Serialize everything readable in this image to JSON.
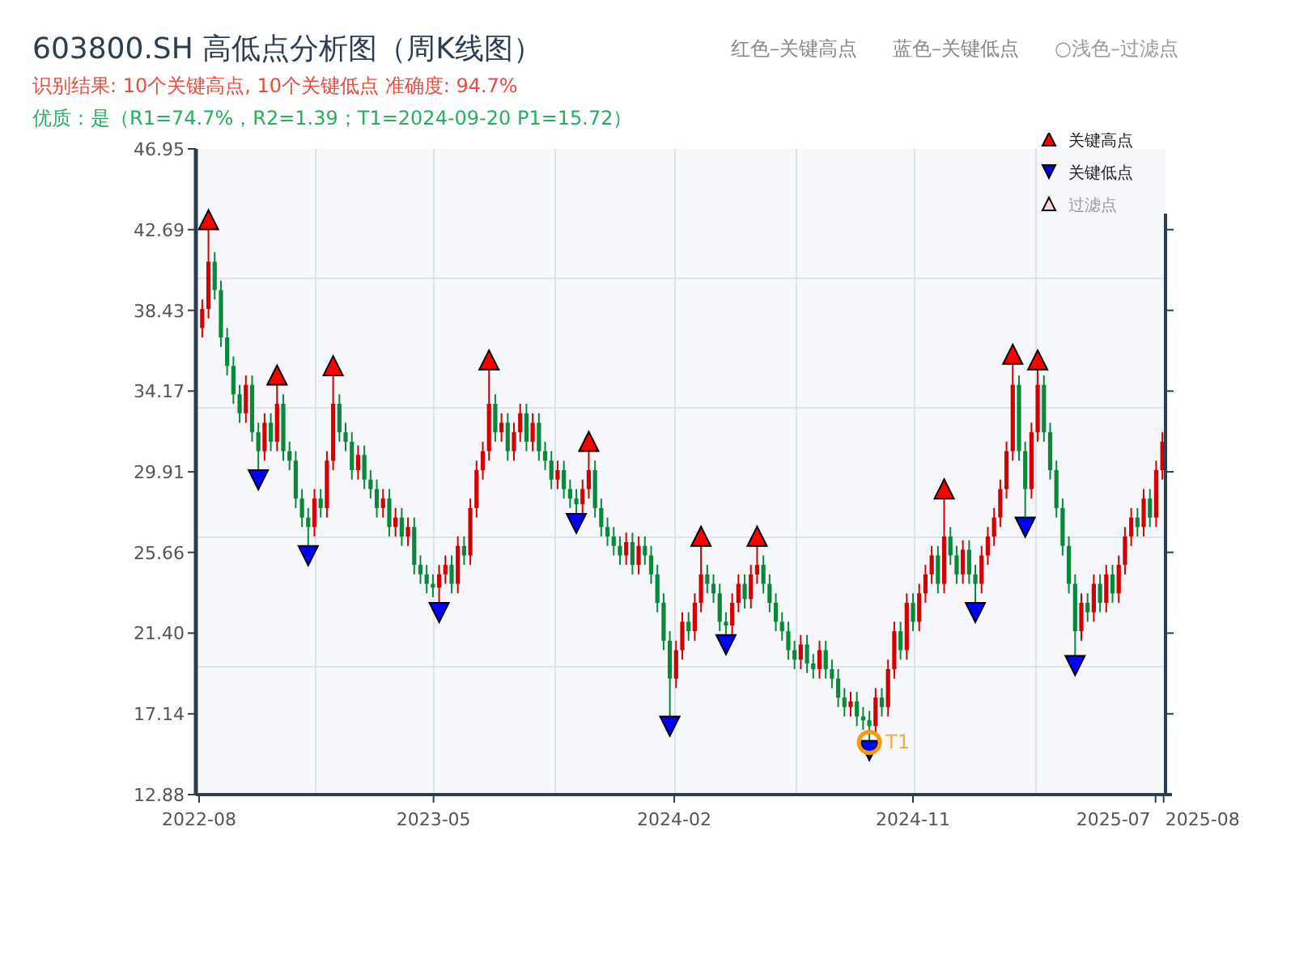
{
  "title": "603800.SH 高低点分析图（周K线图）",
  "top_legend": [
    {
      "kind": "high",
      "label": "红色–关键高点"
    },
    {
      "kind": "low",
      "label": "蓝色–关键低点"
    },
    {
      "kind": "filtered",
      "label": "○浅色–过滤点"
    }
  ],
  "result_line": "识别结果: 10个关键高点, 10个关键低点   准确度: 94.7%",
  "quality_line": "优质：是（R1=74.7%，R2=1.39；T1=2024-09-20 P1=15.72）",
  "chart": {
    "legend": [
      {
        "kind": "high",
        "label": "关键高点"
      },
      {
        "kind": "low",
        "label": "关键低点"
      },
      {
        "kind": "filtered",
        "label": "过滤点"
      }
    ],
    "chart_data": {
      "type": "candlestick",
      "ylim": [
        12.88,
        46.95
      ],
      "yticks": [
        46.95,
        42.69,
        38.43,
        34.17,
        29.91,
        25.66,
        {
          "value": 21.4,
          "label": "21.40"
        },
        17.14,
        12.88
      ],
      "ohlc": [
        [
          37.5,
          39.0,
          37.0,
          38.5
        ],
        [
          38.5,
          42.7,
          38.0,
          41.0
        ],
        [
          41.0,
          41.5,
          39.0,
          39.5
        ],
        [
          39.5,
          40.0,
          36.5,
          37.0
        ],
        [
          37.0,
          37.5,
          35.0,
          35.5
        ],
        [
          35.5,
          36.0,
          33.5,
          34.0
        ],
        [
          34.0,
          34.5,
          32.5,
          33.0
        ],
        [
          33.0,
          35.0,
          32.5,
          34.5
        ],
        [
          34.5,
          35.0,
          31.5,
          32.0
        ],
        [
          32.0,
          32.5,
          30.0,
          31.0
        ],
        [
          31.0,
          33.0,
          30.5,
          32.5
        ],
        [
          32.5,
          33.0,
          31.0,
          31.5
        ],
        [
          31.5,
          34.5,
          31.0,
          33.5
        ],
        [
          33.5,
          34.0,
          30.5,
          31.0
        ],
        [
          31.0,
          31.5,
          30.0,
          30.5
        ],
        [
          30.5,
          31.0,
          28.0,
          28.5
        ],
        [
          28.5,
          29.0,
          27.0,
          27.5
        ],
        [
          27.5,
          28.0,
          26.0,
          27.0
        ],
        [
          27.0,
          29.0,
          26.5,
          28.5
        ],
        [
          28.5,
          29.0,
          27.5,
          28.0
        ],
        [
          28.0,
          31.0,
          27.5,
          30.5
        ],
        [
          30.5,
          35.0,
          30.0,
          33.5
        ],
        [
          33.5,
          34.0,
          31.5,
          32.0
        ],
        [
          32.0,
          32.5,
          31.0,
          31.5
        ],
        [
          31.5,
          32.0,
          29.5,
          30.0
        ],
        [
          30.0,
          31.3,
          29.5,
          30.8
        ],
        [
          30.8,
          31.3,
          29.0,
          29.5
        ],
        [
          29.5,
          30.0,
          28.5,
          29.0
        ],
        [
          29.0,
          29.5,
          27.5,
          28.0
        ],
        [
          28.0,
          29.0,
          27.5,
          28.5
        ],
        [
          28.5,
          29.0,
          26.5,
          27.0
        ],
        [
          27.0,
          28.0,
          26.5,
          27.5
        ],
        [
          27.5,
          28.0,
          26.0,
          26.5
        ],
        [
          26.5,
          27.5,
          26.0,
          27.0
        ],
        [
          27.0,
          27.5,
          24.5,
          25.0
        ],
        [
          25.0,
          25.5,
          24.0,
          24.5
        ],
        [
          24.5,
          25.0,
          23.5,
          24.0
        ],
        [
          24.0,
          24.5,
          23.3,
          23.8
        ],
        [
          23.8,
          25.0,
          23.0,
          24.5
        ],
        [
          24.5,
          25.5,
          24.0,
          25.0
        ],
        [
          25.0,
          25.5,
          23.5,
          24.0
        ],
        [
          24.0,
          26.5,
          23.5,
          26.0
        ],
        [
          26.0,
          26.5,
          25.0,
          25.5
        ],
        [
          25.5,
          28.5,
          25.0,
          28.0
        ],
        [
          28.0,
          30.5,
          27.5,
          30.0
        ],
        [
          30.0,
          31.5,
          29.5,
          31.0
        ],
        [
          31.0,
          35.3,
          30.5,
          33.5
        ],
        [
          33.5,
          34.0,
          31.5,
          32.0
        ],
        [
          32.0,
          33.0,
          31.5,
          32.5
        ],
        [
          32.5,
          33.0,
          30.5,
          31.0
        ],
        [
          31.0,
          32.5,
          30.5,
          32.0
        ],
        [
          32.0,
          33.5,
          31.5,
          33.0
        ],
        [
          33.0,
          33.5,
          31.0,
          31.5
        ],
        [
          31.5,
          33.0,
          31.0,
          32.5
        ],
        [
          32.5,
          33.0,
          30.5,
          31.0
        ],
        [
          31.0,
          31.5,
          30.0,
          30.5
        ],
        [
          30.5,
          31.0,
          29.0,
          29.5
        ],
        [
          29.5,
          30.5,
          29.0,
          30.0
        ],
        [
          30.0,
          30.5,
          28.5,
          29.0
        ],
        [
          29.0,
          29.5,
          28.0,
          28.5
        ],
        [
          28.5,
          29.0,
          27.7,
          28.2
        ],
        [
          28.2,
          29.5,
          27.7,
          29.0
        ],
        [
          29.0,
          31.0,
          28.5,
          30.0
        ],
        [
          30.0,
          30.5,
          27.5,
          28.0
        ],
        [
          28.0,
          28.5,
          26.5,
          27.0
        ],
        [
          27.0,
          27.5,
          26.0,
          26.5
        ],
        [
          26.5,
          27.0,
          25.5,
          26.0
        ],
        [
          26.0,
          26.5,
          25.0,
          25.5
        ],
        [
          25.5,
          26.7,
          25.0,
          26.2
        ],
        [
          26.2,
          26.7,
          24.5,
          25.0
        ],
        [
          25.0,
          26.5,
          24.5,
          26.0
        ],
        [
          26.0,
          26.5,
          25.0,
          25.5
        ],
        [
          25.5,
          26.0,
          24.0,
          24.5
        ],
        [
          24.5,
          25.0,
          22.5,
          23.0
        ],
        [
          23.0,
          23.5,
          20.5,
          21.0
        ],
        [
          21.0,
          21.5,
          17.0,
          19.0
        ],
        [
          19.0,
          21.0,
          18.5,
          20.5
        ],
        [
          20.5,
          22.5,
          20.0,
          22.0
        ],
        [
          22.0,
          22.5,
          21.0,
          21.5
        ],
        [
          21.5,
          23.5,
          21.0,
          23.0
        ],
        [
          23.0,
          26.0,
          22.5,
          24.5
        ],
        [
          24.5,
          25.0,
          23.5,
          24.0
        ],
        [
          24.0,
          24.5,
          23.0,
          23.5
        ],
        [
          23.5,
          24.0,
          21.5,
          22.0
        ],
        [
          22.0,
          22.5,
          21.3,
          21.8
        ],
        [
          21.8,
          23.5,
          21.3,
          23.0
        ],
        [
          23.0,
          24.5,
          22.5,
          24.0
        ],
        [
          24.0,
          24.5,
          22.7,
          23.2
        ],
        [
          23.2,
          25.0,
          22.7,
          24.5
        ],
        [
          24.5,
          26.0,
          24.0,
          25.0
        ],
        [
          25.0,
          25.5,
          23.5,
          24.0
        ],
        [
          24.0,
          24.5,
          22.5,
          23.0
        ],
        [
          23.0,
          23.5,
          21.5,
          22.0
        ],
        [
          22.0,
          22.5,
          21.0,
          21.5
        ],
        [
          21.5,
          22.0,
          20.0,
          20.5
        ],
        [
          20.5,
          21.0,
          19.5,
          20.0
        ],
        [
          20.0,
          21.3,
          19.5,
          20.8
        ],
        [
          20.8,
          21.3,
          19.3,
          19.8
        ],
        [
          19.8,
          20.3,
          19.0,
          19.5
        ],
        [
          19.5,
          21.0,
          19.0,
          20.5
        ],
        [
          20.5,
          21.0,
          19.0,
          19.5
        ],
        [
          19.5,
          20.0,
          18.5,
          19.0
        ],
        [
          19.0,
          19.5,
          17.5,
          18.0
        ],
        [
          18.0,
          18.5,
          17.0,
          17.5
        ],
        [
          17.5,
          18.3,
          17.0,
          17.8
        ],
        [
          17.8,
          18.3,
          16.5,
          17.0
        ],
        [
          17.0,
          17.5,
          16.3,
          16.8
        ],
        [
          16.8,
          17.3,
          15.72,
          16.5
        ],
        [
          16.5,
          18.5,
          16.0,
          18.0
        ],
        [
          18.0,
          18.5,
          17.0,
          17.5
        ],
        [
          17.5,
          20.0,
          17.0,
          19.5
        ],
        [
          19.5,
          22.0,
          19.0,
          21.5
        ],
        [
          21.5,
          22.0,
          20.0,
          20.5
        ],
        [
          20.5,
          23.5,
          20.0,
          23.0
        ],
        [
          23.0,
          23.5,
          21.5,
          22.0
        ],
        [
          22.0,
          24.0,
          21.5,
          23.5
        ],
        [
          23.5,
          25.0,
          23.0,
          24.5
        ],
        [
          24.5,
          26.0,
          24.0,
          25.5
        ],
        [
          25.5,
          26.0,
          23.5,
          24.0
        ],
        [
          24.0,
          28.5,
          23.5,
          26.5
        ],
        [
          26.5,
          27.0,
          25.0,
          25.5
        ],
        [
          25.5,
          26.0,
          24.0,
          24.5
        ],
        [
          24.5,
          26.3,
          24.0,
          25.8
        ],
        [
          25.8,
          26.3,
          24.0,
          24.5
        ],
        [
          24.5,
          25.0,
          23.0,
          24.0
        ],
        [
          24.0,
          26.0,
          23.5,
          25.5
        ],
        [
          25.5,
          27.0,
          25.0,
          26.5
        ],
        [
          26.5,
          28.0,
          26.0,
          27.5
        ],
        [
          27.5,
          29.5,
          27.0,
          29.0
        ],
        [
          29.0,
          31.5,
          28.5,
          31.0
        ],
        [
          31.0,
          35.6,
          30.5,
          34.5
        ],
        [
          34.5,
          35.0,
          30.5,
          31.0
        ],
        [
          31.0,
          31.5,
          27.5,
          29.0
        ],
        [
          29.0,
          32.5,
          28.5,
          32.0
        ],
        [
          32.0,
          35.3,
          31.5,
          34.5
        ],
        [
          34.5,
          35.0,
          31.5,
          32.0
        ],
        [
          32.0,
          32.5,
          29.5,
          30.0
        ],
        [
          30.0,
          30.5,
          27.5,
          28.0
        ],
        [
          28.0,
          28.5,
          25.5,
          26.0
        ],
        [
          26.0,
          26.5,
          23.5,
          24.0
        ],
        [
          24.0,
          24.5,
          20.2,
          21.5
        ],
        [
          21.5,
          23.5,
          21.0,
          23.0
        ],
        [
          23.0,
          23.5,
          22.0,
          22.5
        ],
        [
          22.5,
          24.5,
          22.0,
          24.0
        ],
        [
          24.0,
          24.5,
          22.5,
          23.0
        ],
        [
          23.0,
          25.0,
          22.5,
          24.5
        ],
        [
          24.5,
          25.0,
          23.0,
          23.5
        ],
        [
          23.5,
          25.5,
          23.0,
          25.0
        ],
        [
          25.0,
          27.0,
          24.5,
          26.5
        ],
        [
          26.5,
          28.0,
          26.0,
          27.5
        ],
        [
          27.5,
          28.0,
          26.5,
          27.0
        ],
        [
          27.0,
          29.0,
          26.5,
          28.5
        ],
        [
          28.5,
          29.0,
          27.0,
          27.5
        ],
        [
          27.5,
          30.5,
          27.0,
          30.0
        ],
        [
          30.0,
          32.0,
          29.5,
          31.5
        ]
      ]
    },
    "x_ticks": [
      "2022-08",
      "2023-05",
      "2024-02",
      "2024-11",
      "2025-07",
      "2025-08"
    ],
    "key_points": [
      {
        "kind": "high"
      },
      {
        "kind": "high"
      },
      {
        "kind": "high"
      },
      {
        "kind": "high"
      },
      {
        "kind": "high"
      },
      {
        "kind": "high"
      },
      {
        "kind": "high"
      },
      {
        "kind": "high"
      },
      {
        "kind": "high"
      },
      {
        "kind": "high"
      },
      {
        "kind": "low"
      },
      {
        "kind": "low"
      },
      {
        "kind": "low"
      },
      {
        "kind": "low"
      },
      {
        "kind": "low"
      },
      {
        "kind": "low"
      },
      {
        "kind": "low"
      },
      {
        "kind": "low"
      },
      {
        "kind": "low"
      },
      {
        "kind": "low"
      }
    ],
    "t1": {
      "label": "T1"
    }
  }
}
